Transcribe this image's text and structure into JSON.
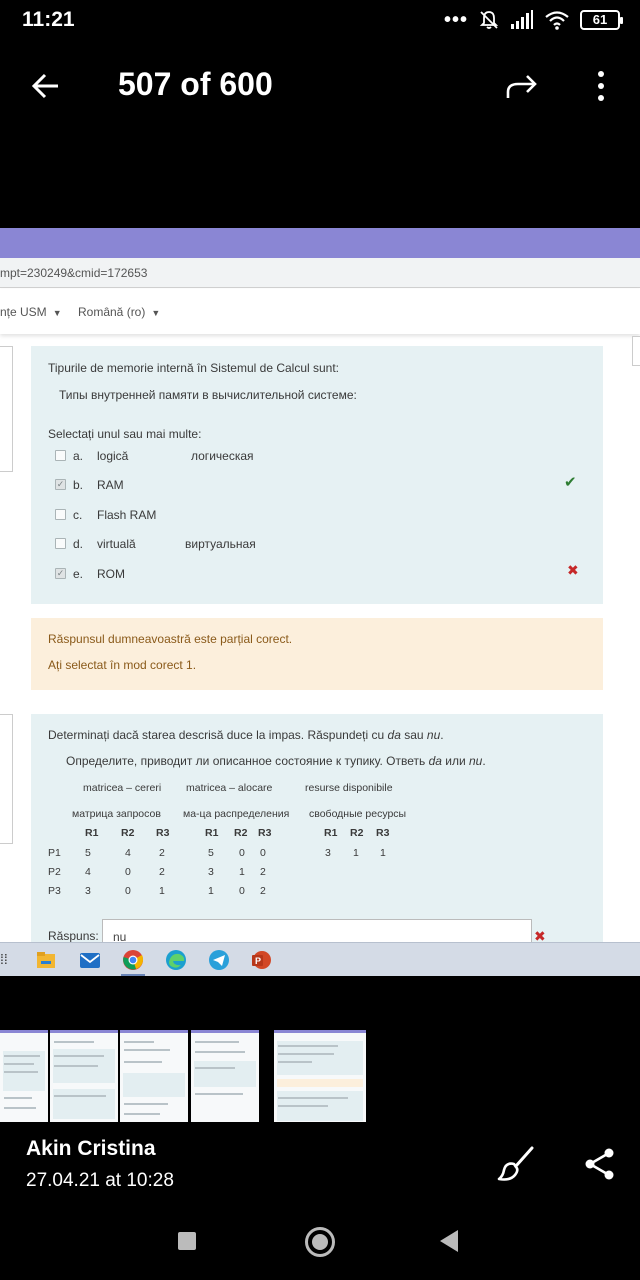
{
  "status_bar": {
    "time": "11:21",
    "overflow_dots": "•••",
    "battery": "61",
    "icons": [
      "mute-bell-icon",
      "signal-icon",
      "wifi-icon",
      "battery-icon"
    ]
  },
  "viewer": {
    "counter": "507 of 600",
    "icons": [
      "back-arrow-icon",
      "forward-share-icon",
      "more-vert-icon"
    ]
  },
  "photo": {
    "url_fragment": "mpt=230249&cmid=172653",
    "nav": {
      "menu1": "nțe USM",
      "lang": "Română (ro)"
    },
    "question1": {
      "prompt_ro": "Tipurile de memorie internă în Sistemul de Calcul sunt:",
      "prompt_ru": "Типы внутренней памяти в вычислительной системе:",
      "instruction": "Selectați unul sau mai multe:",
      "options": [
        {
          "letter": "a.",
          "text": "logică",
          "ru": "логическая",
          "checked": false,
          "mark": ""
        },
        {
          "letter": "b.",
          "text": "RAM",
          "ru": "",
          "checked": true,
          "mark": "correct"
        },
        {
          "letter": "c.",
          "text": "Flash RAM",
          "ru": "",
          "checked": false,
          "mark": ""
        },
        {
          "letter": "d.",
          "text": "virtuală",
          "ru": "виртуальная",
          "checked": false,
          "mark": ""
        },
        {
          "letter": "e.",
          "text": "ROM",
          "ru": "",
          "checked": true,
          "mark": "incorrect"
        }
      ],
      "mark_ok": "✔",
      "mark_bad": "✖"
    },
    "feedback": {
      "line1": "Răspunsul dumneavoastră este parțial corect.",
      "line2": "Ați selectat în mod corect 1."
    },
    "question2": {
      "prompt_ro_pre": "Determinați dacă starea descrisă duce la impas. Răspundeți cu ",
      "prompt_ro_da": "da",
      "prompt_ro_mid": " sau ",
      "prompt_ro_nu": "nu",
      "prompt_ro_end": ".",
      "prompt_ru_pre": "Определите, приводит ли описанное состояние к тупику. Ответь ",
      "prompt_ru_da": "da",
      "prompt_ru_mid": " или ",
      "prompt_ru_nu": "nu",
      "prompt_ru_end": ".",
      "table": {
        "group_ro": [
          "matricea – cereri",
          "matricea – alocare",
          "resurse disponibile"
        ],
        "group_ru": [
          "матрица запросов",
          "ма-ца распределения",
          "свободные ресурсы"
        ],
        "col_headers": [
          "R1",
          "R2",
          "R3",
          "R1",
          "R2",
          "R3",
          "R1",
          "R2",
          "R3"
        ],
        "rows": [
          {
            "label": "P1",
            "values": [
              "5",
              "4",
              "2",
              "5",
              "0",
              "0",
              "3",
              "1",
              "1"
            ]
          },
          {
            "label": "P2",
            "values": [
              "4",
              "0",
              "2",
              "3",
              "1",
              "2",
              "",
              "",
              ""
            ]
          },
          {
            "label": "P3",
            "values": [
              "3",
              "0",
              "1",
              "1",
              "0",
              "2",
              "",
              "",
              ""
            ]
          }
        ]
      },
      "answer_label": "Răspuns:",
      "answer_value": "nu",
      "answer_mark": "✖"
    },
    "taskbar": {
      "grip": "⁞⁞",
      "apps": [
        "file-explorer-icon",
        "mail-icon",
        "chrome-icon",
        "edge-icon",
        "telegram-icon",
        "powerpoint-icon"
      ]
    }
  },
  "thumbnails_count": 5,
  "info": {
    "author": "Akin Cristina",
    "date": "27.04.21 at 10:28",
    "icons": [
      "brush-edit-icon",
      "share-icon"
    ]
  },
  "system_nav": [
    "recent-apps-button",
    "home-button",
    "back-button"
  ]
}
